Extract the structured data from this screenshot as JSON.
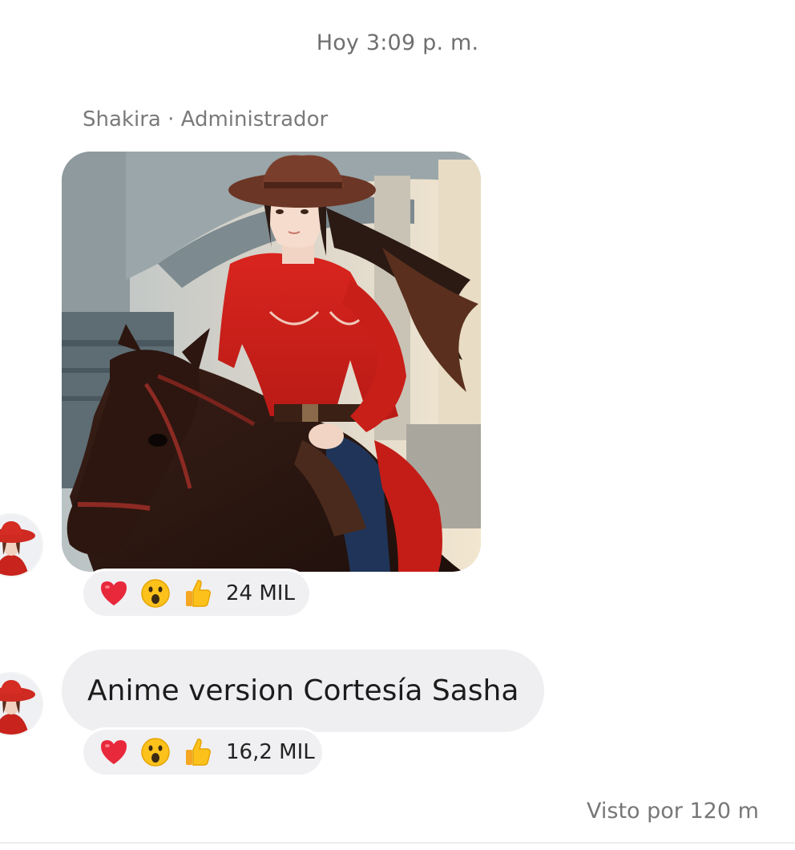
{
  "chat": {
    "timestamp": "Hoy 3:09 p. m.",
    "sender_line": "Shakira · Administrador",
    "seen_text": "Visto por 120 m"
  },
  "messages": [
    {
      "type": "image",
      "image_icon": "anime-cowgirl-on-horse-illustration",
      "reactions": {
        "icons": [
          "heart",
          "wow-face",
          "thumbs-up"
        ],
        "count": "24 MIL"
      }
    },
    {
      "type": "text",
      "text": "Anime version Cortesía Sasha",
      "reactions": {
        "icons": [
          "heart",
          "wow-face",
          "thumbs-up"
        ],
        "count": "16,2 MIL"
      }
    }
  ],
  "colors": {
    "bubble_bg": "#efeff1",
    "reaction_bg": "#f0f0f2",
    "heart": "#e8283b",
    "emoji_yellow": "#fcc21b",
    "meta_text": "#7a7a7a"
  }
}
